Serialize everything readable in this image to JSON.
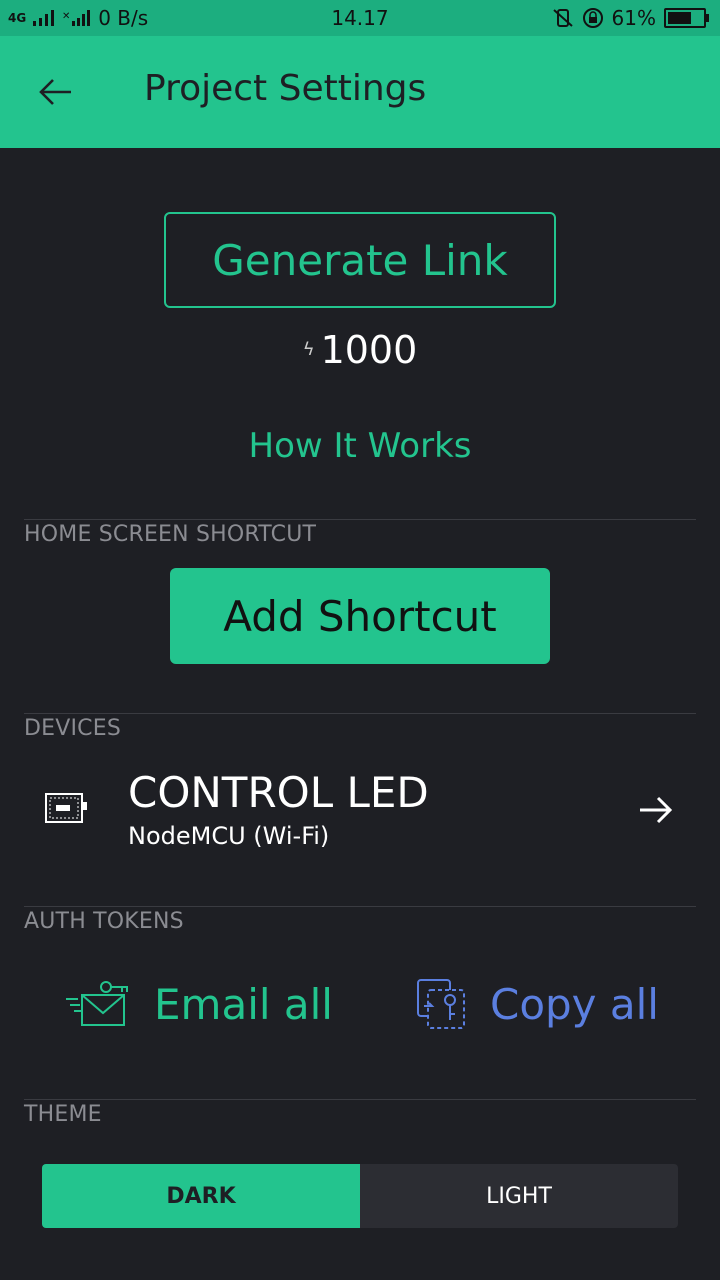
{
  "status_bar": {
    "network": "4G",
    "data_speed": "0 B/s",
    "time": "14.17",
    "battery": "61%"
  },
  "app_bar": {
    "title": "Project Settings"
  },
  "share": {
    "generate_label": "Generate Link",
    "energy_value": "1000",
    "how_it_works": "How It Works"
  },
  "home_shortcut": {
    "section": "HOME SCREEN SHORTCUT",
    "button_label": "Add Shortcut"
  },
  "devices": {
    "section": "DEVICES",
    "items": [
      {
        "name": "CONTROL LED",
        "type": "NodeMCU (Wi-Fi)"
      }
    ]
  },
  "auth_tokens": {
    "section": "AUTH TOKENS",
    "email_label": "Email all",
    "copy_label": "Copy all"
  },
  "theme": {
    "section": "THEME",
    "options": [
      "DARK",
      "LIGHT"
    ],
    "selected": "DARK"
  },
  "colors": {
    "accent": "#23c48e",
    "background": "#1e1f24",
    "copy_blue": "#5b7fe0"
  }
}
